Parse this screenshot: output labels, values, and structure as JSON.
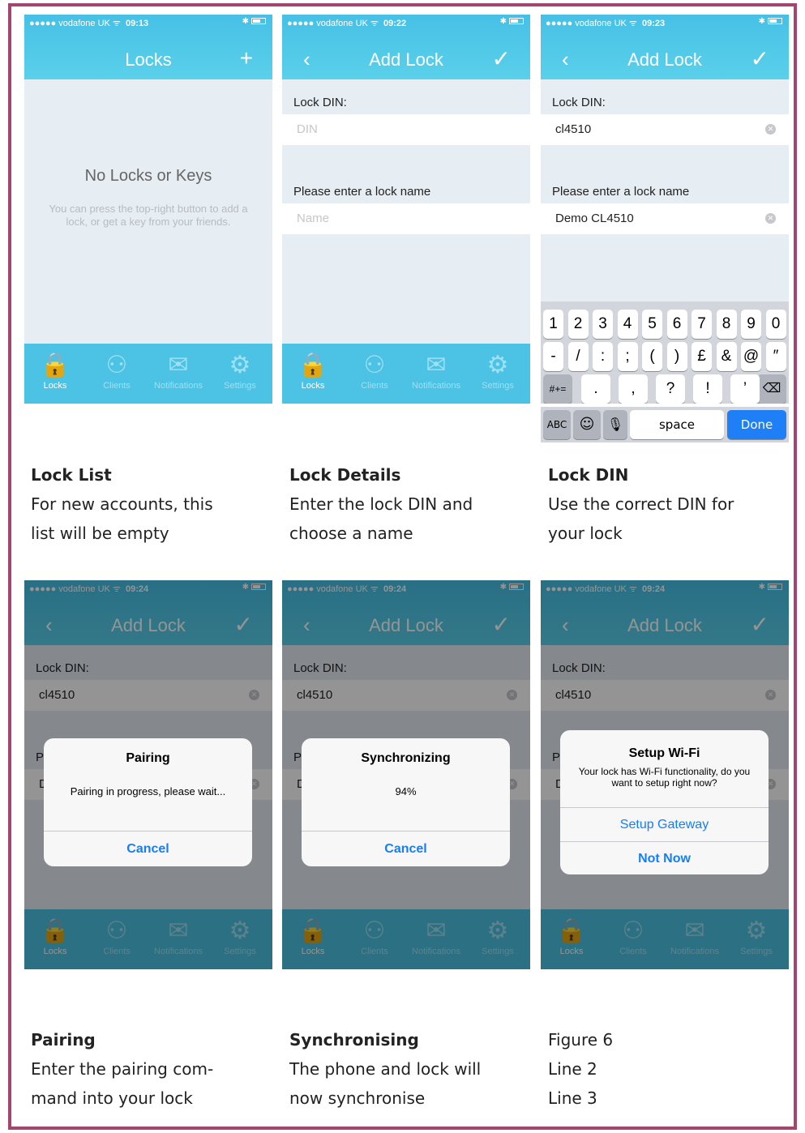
{
  "status": {
    "carrier": "●●●●● vodafone UK ᯤ",
    "times": [
      "09:13",
      "09:22",
      "09:23",
      "09:24",
      "09:24",
      "09:24"
    ]
  },
  "tabs": [
    "Locks",
    "Clients",
    "Notifications",
    "Settings"
  ],
  "screens": {
    "list": {
      "title": "Locks",
      "add_icon": "+",
      "empty_title": "No Locks or Keys",
      "empty_sub": "You can press the top-right button to add a lock, or get a key from your friends."
    },
    "add": {
      "title": "Add Lock",
      "back": "‹",
      "confirm": "✓"
    },
    "form": {
      "din_label": "Lock DIN:",
      "din_placeholder": "DIN",
      "name_label": "Please enter a lock name",
      "name_placeholder": "Name",
      "din_value": "cl4510",
      "name_value": "Demo CL4510"
    }
  },
  "keyboard": {
    "row1": [
      "1",
      "2",
      "3",
      "4",
      "5",
      "6",
      "7",
      "8",
      "9",
      "0"
    ],
    "row2": [
      "-",
      "/",
      ":",
      ";",
      "(",
      ")",
      "£",
      "&",
      "@",
      "″"
    ],
    "row3_left": "#+=",
    "row3": [
      ".",
      ",",
      "?",
      "!",
      "’"
    ],
    "abc": "ABC",
    "space": "space",
    "done": "Done"
  },
  "alerts": {
    "pairing": {
      "title": "Pairing",
      "message": "Pairing in progress, please wait...",
      "button": "Cancel"
    },
    "sync": {
      "title": "Synchronizing",
      "message": "94%",
      "button": "Cancel"
    },
    "wifi": {
      "title": "Setup Wi-Fi",
      "message": "Your lock has Wi-Fi functionality, do you want to setup right now?",
      "button1": "Setup Gateway",
      "button2": "Not Now"
    }
  },
  "captions": [
    {
      "title": "Lock List",
      "line1": "For new accounts, this",
      "line2": "list will be empty"
    },
    {
      "title": "Lock Details",
      "line1": "Enter the lock DIN and",
      "line2": "choose a name"
    },
    {
      "title": "Lock DIN",
      "line1": "Use the correct DIN for",
      "line2": "your lock"
    },
    {
      "title": "Pairing",
      "line1": "Enter the pairing com-",
      "line2": "mand into your lock"
    },
    {
      "title": "Synchronising",
      "line1": "The phone and lock will",
      "line2": "now synchronise"
    },
    {
      "title": "Figure 6",
      "line1": "Line 2",
      "line2": "Line 3"
    }
  ]
}
